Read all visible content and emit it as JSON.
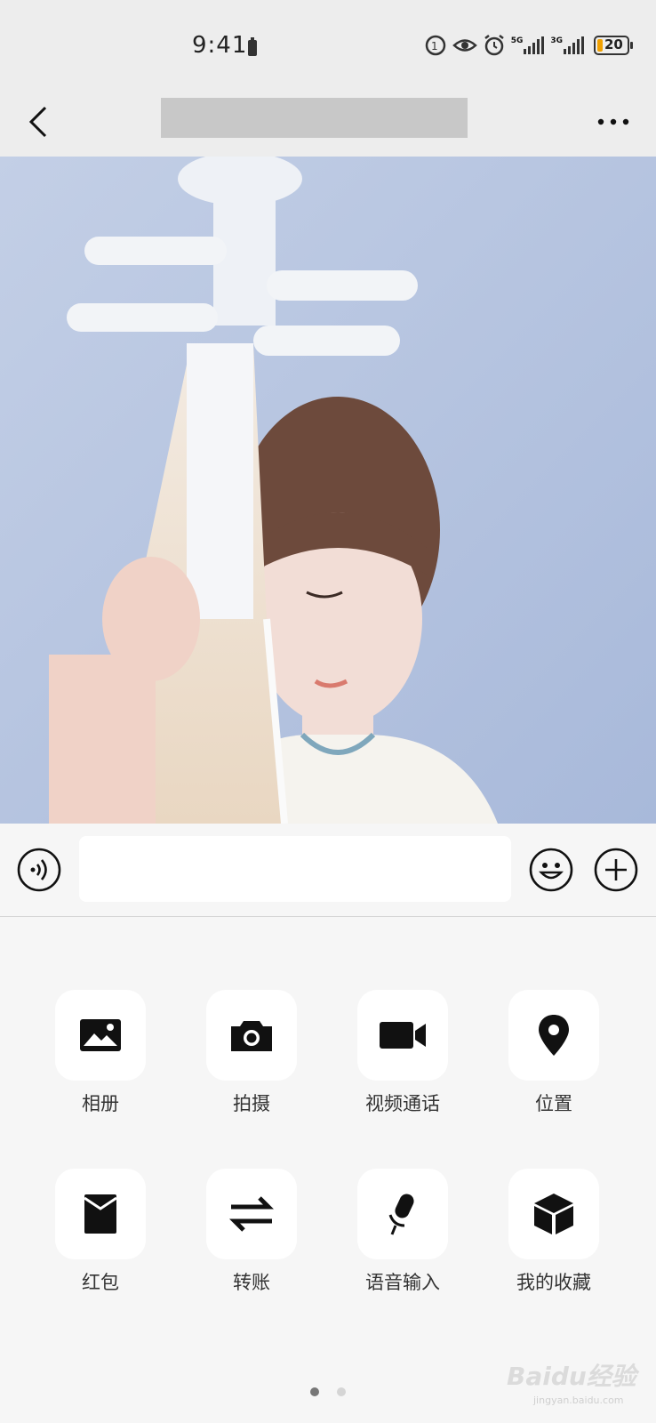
{
  "status_bar": {
    "time": "9:41",
    "battery": "20",
    "network_1": "5G",
    "network_2": "3G"
  },
  "chat": {
    "image_description": "photo"
  },
  "input": {
    "placeholder": ""
  },
  "panel": {
    "items": [
      {
        "label": "相册",
        "icon": "photo-album-icon"
      },
      {
        "label": "拍摄",
        "icon": "camera-icon"
      },
      {
        "label": "视频通话",
        "icon": "video-call-icon"
      },
      {
        "label": "位置",
        "icon": "location-pin-icon"
      },
      {
        "label": "红包",
        "icon": "red-packet-icon"
      },
      {
        "label": "转账",
        "icon": "transfer-icon"
      },
      {
        "label": "语音输入",
        "icon": "microphone-icon"
      },
      {
        "label": "我的收藏",
        "icon": "favorites-box-icon"
      }
    ],
    "page_count": 2,
    "current_page": 1
  },
  "watermark": {
    "brand": "Baidu经验",
    "url": "jingyan.baidu.com"
  }
}
